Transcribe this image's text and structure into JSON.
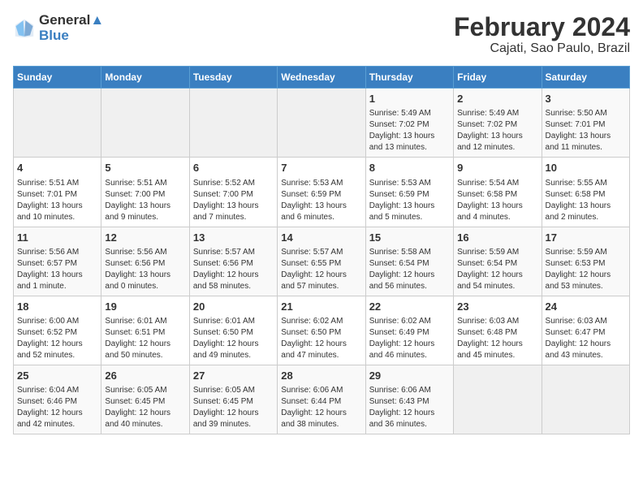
{
  "header": {
    "logo_line1": "General",
    "logo_line2": "Blue",
    "title": "February 2024",
    "subtitle": "Cajati, Sao Paulo, Brazil"
  },
  "days_of_week": [
    "Sunday",
    "Monday",
    "Tuesday",
    "Wednesday",
    "Thursday",
    "Friday",
    "Saturday"
  ],
  "weeks": [
    [
      {
        "num": "",
        "info": ""
      },
      {
        "num": "",
        "info": ""
      },
      {
        "num": "",
        "info": ""
      },
      {
        "num": "",
        "info": ""
      },
      {
        "num": "1",
        "info": "Sunrise: 5:49 AM\nSunset: 7:02 PM\nDaylight: 13 hours\nand 13 minutes."
      },
      {
        "num": "2",
        "info": "Sunrise: 5:49 AM\nSunset: 7:02 PM\nDaylight: 13 hours\nand 12 minutes."
      },
      {
        "num": "3",
        "info": "Sunrise: 5:50 AM\nSunset: 7:01 PM\nDaylight: 13 hours\nand 11 minutes."
      }
    ],
    [
      {
        "num": "4",
        "info": "Sunrise: 5:51 AM\nSunset: 7:01 PM\nDaylight: 13 hours\nand 10 minutes."
      },
      {
        "num": "5",
        "info": "Sunrise: 5:51 AM\nSunset: 7:00 PM\nDaylight: 13 hours\nand 9 minutes."
      },
      {
        "num": "6",
        "info": "Sunrise: 5:52 AM\nSunset: 7:00 PM\nDaylight: 13 hours\nand 7 minutes."
      },
      {
        "num": "7",
        "info": "Sunrise: 5:53 AM\nSunset: 6:59 PM\nDaylight: 13 hours\nand 6 minutes."
      },
      {
        "num": "8",
        "info": "Sunrise: 5:53 AM\nSunset: 6:59 PM\nDaylight: 13 hours\nand 5 minutes."
      },
      {
        "num": "9",
        "info": "Sunrise: 5:54 AM\nSunset: 6:58 PM\nDaylight: 13 hours\nand 4 minutes."
      },
      {
        "num": "10",
        "info": "Sunrise: 5:55 AM\nSunset: 6:58 PM\nDaylight: 13 hours\nand 2 minutes."
      }
    ],
    [
      {
        "num": "11",
        "info": "Sunrise: 5:56 AM\nSunset: 6:57 PM\nDaylight: 13 hours\nand 1 minute."
      },
      {
        "num": "12",
        "info": "Sunrise: 5:56 AM\nSunset: 6:56 PM\nDaylight: 13 hours\nand 0 minutes."
      },
      {
        "num": "13",
        "info": "Sunrise: 5:57 AM\nSunset: 6:56 PM\nDaylight: 12 hours\nand 58 minutes."
      },
      {
        "num": "14",
        "info": "Sunrise: 5:57 AM\nSunset: 6:55 PM\nDaylight: 12 hours\nand 57 minutes."
      },
      {
        "num": "15",
        "info": "Sunrise: 5:58 AM\nSunset: 6:54 PM\nDaylight: 12 hours\nand 56 minutes."
      },
      {
        "num": "16",
        "info": "Sunrise: 5:59 AM\nSunset: 6:54 PM\nDaylight: 12 hours\nand 54 minutes."
      },
      {
        "num": "17",
        "info": "Sunrise: 5:59 AM\nSunset: 6:53 PM\nDaylight: 12 hours\nand 53 minutes."
      }
    ],
    [
      {
        "num": "18",
        "info": "Sunrise: 6:00 AM\nSunset: 6:52 PM\nDaylight: 12 hours\nand 52 minutes."
      },
      {
        "num": "19",
        "info": "Sunrise: 6:01 AM\nSunset: 6:51 PM\nDaylight: 12 hours\nand 50 minutes."
      },
      {
        "num": "20",
        "info": "Sunrise: 6:01 AM\nSunset: 6:50 PM\nDaylight: 12 hours\nand 49 minutes."
      },
      {
        "num": "21",
        "info": "Sunrise: 6:02 AM\nSunset: 6:50 PM\nDaylight: 12 hours\nand 47 minutes."
      },
      {
        "num": "22",
        "info": "Sunrise: 6:02 AM\nSunset: 6:49 PM\nDaylight: 12 hours\nand 46 minutes."
      },
      {
        "num": "23",
        "info": "Sunrise: 6:03 AM\nSunset: 6:48 PM\nDaylight: 12 hours\nand 45 minutes."
      },
      {
        "num": "24",
        "info": "Sunrise: 6:03 AM\nSunset: 6:47 PM\nDaylight: 12 hours\nand 43 minutes."
      }
    ],
    [
      {
        "num": "25",
        "info": "Sunrise: 6:04 AM\nSunset: 6:46 PM\nDaylight: 12 hours\nand 42 minutes."
      },
      {
        "num": "26",
        "info": "Sunrise: 6:05 AM\nSunset: 6:45 PM\nDaylight: 12 hours\nand 40 minutes."
      },
      {
        "num": "27",
        "info": "Sunrise: 6:05 AM\nSunset: 6:45 PM\nDaylight: 12 hours\nand 39 minutes."
      },
      {
        "num": "28",
        "info": "Sunrise: 6:06 AM\nSunset: 6:44 PM\nDaylight: 12 hours\nand 38 minutes."
      },
      {
        "num": "29",
        "info": "Sunrise: 6:06 AM\nSunset: 6:43 PM\nDaylight: 12 hours\nand 36 minutes."
      },
      {
        "num": "",
        "info": ""
      },
      {
        "num": "",
        "info": ""
      }
    ]
  ]
}
